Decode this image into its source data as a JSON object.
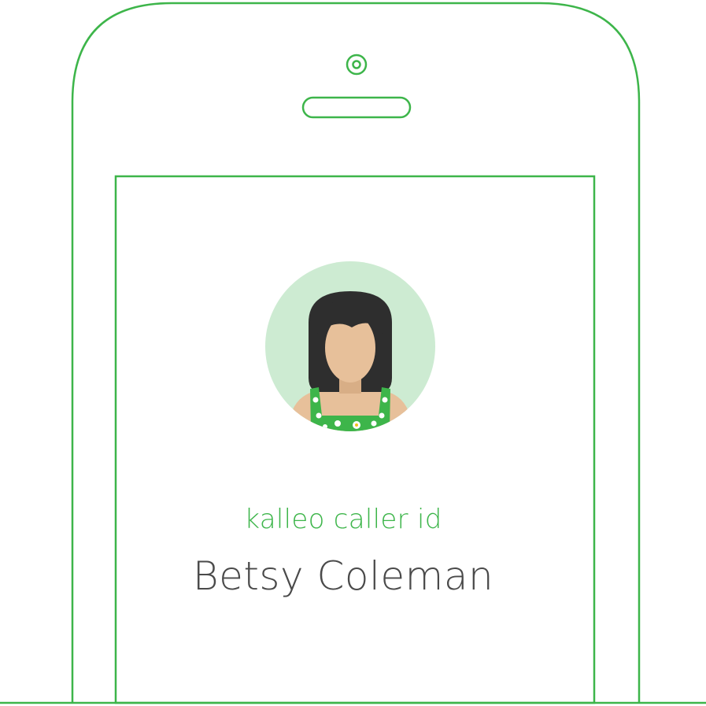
{
  "colors": {
    "accent": "#3db54a",
    "avatar_bg": "#cdebd2",
    "name_text": "#4a4a4a",
    "hair": "#2e2e2e",
    "skin": "#e7c09a",
    "skin_shadow": "#d8ae86",
    "dress": "#3db54a",
    "flower": "#ffffff",
    "flower_center": "#f0c419"
  },
  "caller": {
    "brand_label": "kalleo caller id",
    "name": "Betsy Coleman"
  },
  "icons": {
    "camera": "front-camera-icon",
    "speaker": "earpiece-speaker-icon",
    "avatar": "woman-avatar-icon"
  }
}
